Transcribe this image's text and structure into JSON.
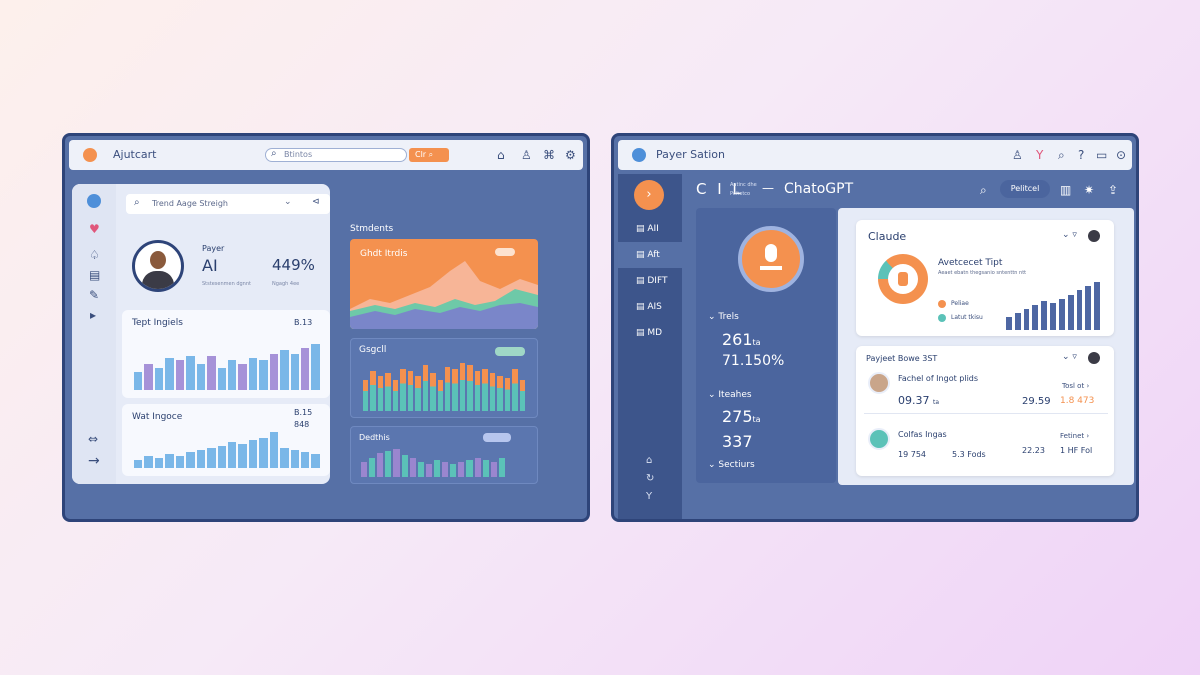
{
  "left": {
    "title": "Ajutcart",
    "search": {
      "placeholder": "Btintos",
      "button": "Clr"
    },
    "sub_search": "Trend Aage Streigh",
    "profile": {
      "label": "Payer",
      "name": "AI",
      "pct": "449%",
      "sub1": "Ststesenmen dgnnt",
      "sub2": "Ngagh 4ee"
    },
    "sect": "Stmdents",
    "c1": {
      "title": "Tept Ingiels",
      "value": "B.13"
    },
    "c2": {
      "title": "Wat Ingoce",
      "v1": "B.15",
      "v2": "848"
    },
    "oc": {
      "title": "Ghdt Itrdis"
    },
    "gc": {
      "title": "Gsgcll"
    },
    "pc": {
      "title": "Dedthis"
    },
    "bars1": [
      18,
      26,
      22,
      32,
      30,
      34,
      26,
      34,
      22,
      30,
      26,
      32,
      30,
      36,
      40,
      36,
      42,
      46
    ],
    "bars2": [
      8,
      12,
      10,
      14,
      12,
      16,
      18,
      20,
      22,
      26,
      24,
      28,
      30,
      36,
      20,
      18,
      16,
      14
    ],
    "gbars": [
      30,
      38,
      34,
      36,
      30,
      40,
      38,
      34,
      44,
      36,
      30,
      42,
      40,
      46,
      44,
      38,
      40,
      36,
      34,
      32,
      40,
      30
    ],
    "pbars": [
      14,
      18,
      22,
      24,
      26,
      20,
      18,
      14,
      12,
      16,
      14,
      12,
      14,
      16,
      18,
      16,
      14,
      18
    ],
    "colors": {
      "accent": "#f4914f",
      "blue": "#7ab7e8",
      "purple": "#a692d8",
      "teal": "#5bc2b8",
      "navy": "#2e4479"
    }
  },
  "right": {
    "title": "Payer Sation",
    "head_left": "C I L",
    "head_small1": "Aatinc dhe",
    "head_small2": "Poitetco",
    "head_arrow": "—",
    "head_title": "ChatoGPT",
    "head_btn": "Pelitcel",
    "nav": [
      "AII",
      "Aft",
      "DIFT",
      "AIS",
      "MD"
    ],
    "s1": {
      "label": "Trels",
      "v1": "261",
      "v1s": "ta",
      "v2": "71.150%"
    },
    "s2": {
      "label": "Iteahes",
      "v1": "275",
      "v1s": "ta",
      "v2": "337"
    },
    "s3": {
      "label": "Sectiurs"
    },
    "claude": {
      "title": "Claude",
      "sub": "Avetcecet Tipt",
      "subsub": "Aeaet ebatn thegsanio sntenttn ntt",
      "leg1": "Peliae",
      "leg2": "Latut tkisu",
      "bars": [
        12,
        16,
        20,
        24,
        28,
        26,
        30,
        34,
        38,
        42,
        46
      ]
    },
    "list": {
      "title": "Payjeet Bowe 3ST",
      "r1": {
        "name": "Fachel of Ingot plids",
        "a": "09.37",
        "as": "ta",
        "b": "29.59",
        "c": "1.8 473",
        "link": "Tosl ot"
      },
      "r2": {
        "name": "Colfas Ingas",
        "a": "19 754",
        "b": "5.3 Fods",
        "c": "22.23",
        "d": "1 HF Fol",
        "link": "Fetinet"
      }
    },
    "colors": {
      "sidebar": "#3d558b",
      "panel": "#4b659e",
      "accent": "#f4914f"
    }
  }
}
